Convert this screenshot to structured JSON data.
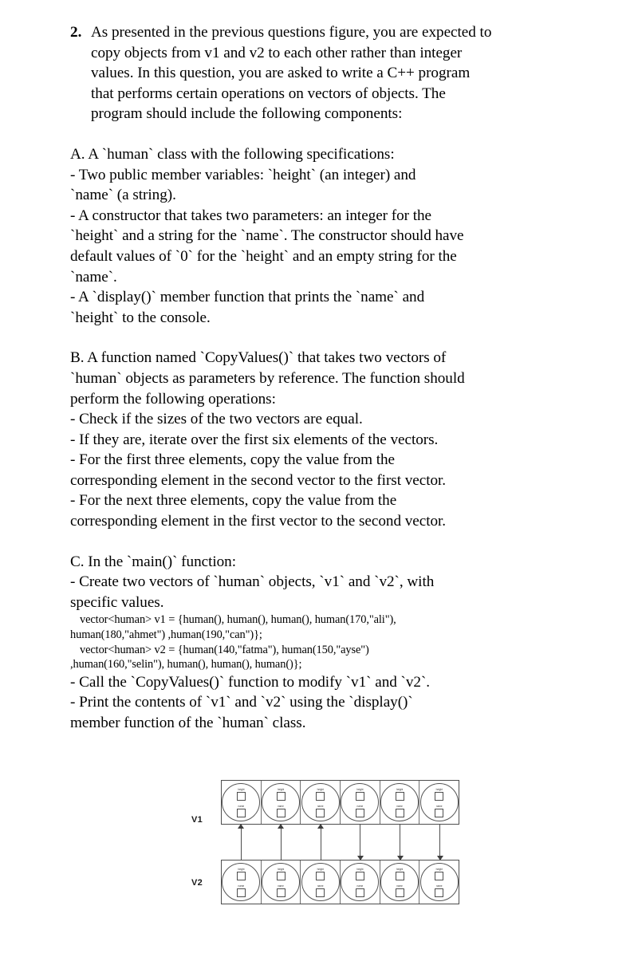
{
  "question": {
    "number": "2.",
    "intro_lines": [
      "As presented in the previous questions figure, you are expected to",
      "copy objects from v1 and v2 to each other rather than integer",
      "values. In this question, you are asked to write a C++ program",
      "that performs certain operations on vectors of objects. The",
      "program should include the following components:"
    ],
    "section_a": {
      "heading": "A. A `human` class with the following specifications:",
      "lines": [
        " - Two public member variables: `height` (an integer) and",
        "`name` (a string).",
        " - A constructor that takes two parameters: an integer for the",
        "`height` and a string for the `name`. The constructor should have",
        "default values of `0` for the `height` and an empty string for the",
        "`name`.",
        " - A `display()` member function that prints the `name` and",
        "`height` to the console."
      ]
    },
    "section_b": {
      "heading": "B. A function named `CopyValues()` that takes two vectors of",
      "lines": [
        "`human` objects as parameters by reference. The function should",
        "perform the following operations:",
        " - Check if the sizes of the two vectors are equal.",
        " - If they are, iterate over the first six elements of the vectors.",
        " - For the first three elements, copy the value from the",
        "corresponding element in the second vector to the first vector.",
        " - For the next three elements, copy the value from the",
        "corresponding element in the first vector to the second vector."
      ]
    },
    "section_c": {
      "heading": "C. In the `main()` function:",
      "lines_before_code": [
        " - Create two vectors of `human` objects, `v1` and `v2`, with",
        "specific values."
      ],
      "code_lines": [
        "vector<human> v1 = {human(), human(), human(), human(170,\"ali\"),",
        "human(180,\"ahmet\") ,human(190,\"can\")};",
        "vector<human> v2 = {human(140,\"fatma\"), human(150,\"ayse\")",
        ",human(160,\"selin\"), human(), human(), human()};"
      ],
      "lines_after_code": [
        " - Call the `CopyValues()` function to modify `v1` and `v2`.",
        " - Print the contents of `v1` and `v2` using the `display()`",
        "member function of the `human` class."
      ]
    }
  },
  "figure": {
    "row_labels": {
      "v1": "V1",
      "v2": "V2"
    },
    "cell_count": 6,
    "object_fields": {
      "height": "height",
      "name": "name"
    },
    "arrows": [
      {
        "direction": "up"
      },
      {
        "direction": "up"
      },
      {
        "direction": "up"
      },
      {
        "direction": "down"
      },
      {
        "direction": "down"
      },
      {
        "direction": "down"
      }
    ],
    "colors": {
      "line": "#4d4d4d",
      "background": "#ffffff"
    }
  }
}
